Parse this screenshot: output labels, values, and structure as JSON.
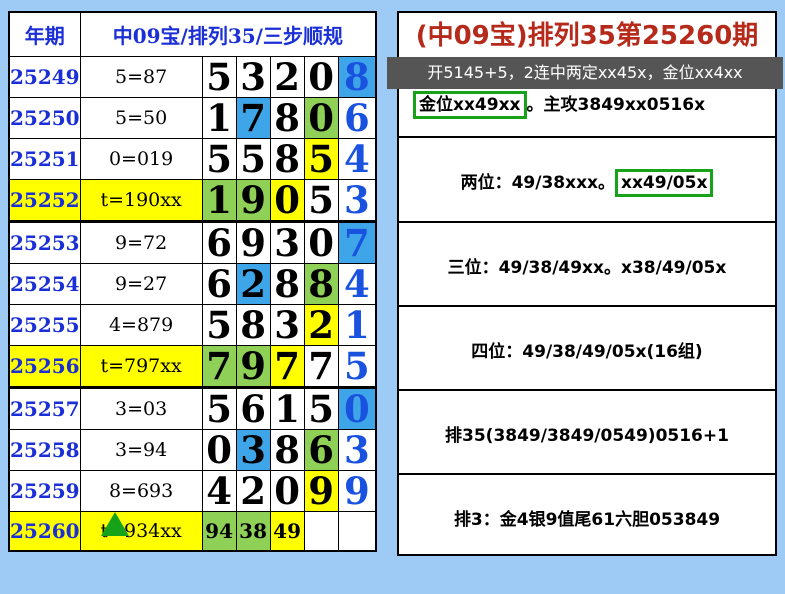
{
  "header": {
    "col_period": "年期",
    "col_title": "中09宝/排列35/三步顺规"
  },
  "rows": [
    {
      "period": "25249",
      "rule": "5=87",
      "highlight": false,
      "digits": [
        "5",
        "3",
        "2",
        "0",
        "8"
      ],
      "bgs": [
        "white",
        "white",
        "white",
        "white",
        "blue"
      ]
    },
    {
      "period": "25250",
      "rule": "5=50",
      "highlight": false,
      "digits": [
        "1",
        "7",
        "8",
        "0",
        "6"
      ],
      "bgs": [
        "white",
        "blue",
        "white",
        "green",
        "white"
      ]
    },
    {
      "period": "25251",
      "rule": "0=019",
      "highlight": false,
      "digits": [
        "5",
        "5",
        "8",
        "5",
        "4"
      ],
      "bgs": [
        "white",
        "white",
        "white",
        "yellow",
        "white"
      ]
    },
    {
      "period": "25252",
      "rule": "t=190xx",
      "highlight": true,
      "digits": [
        "1",
        "9",
        "0",
        "5",
        "3"
      ],
      "bgs": [
        "green",
        "green",
        "yellow",
        "white",
        "white"
      ]
    },
    {
      "period": "25253",
      "rule": "9=72",
      "highlight": false,
      "digits": [
        "6",
        "9",
        "3",
        "0",
        "7"
      ],
      "bgs": [
        "white",
        "white",
        "white",
        "white",
        "blue"
      ]
    },
    {
      "period": "25254",
      "rule": "9=27",
      "highlight": false,
      "digits": [
        "6",
        "2",
        "8",
        "8",
        "4"
      ],
      "bgs": [
        "white",
        "blue",
        "white",
        "green",
        "white"
      ]
    },
    {
      "period": "25255",
      "rule": "4=879",
      "highlight": false,
      "digits": [
        "5",
        "8",
        "3",
        "2",
        "1"
      ],
      "bgs": [
        "white",
        "white",
        "white",
        "yellow",
        "white"
      ]
    },
    {
      "period": "25256",
      "rule": "t=797xx",
      "highlight": true,
      "digits": [
        "7",
        "9",
        "7",
        "7",
        "5"
      ],
      "bgs": [
        "green",
        "green",
        "yellow",
        "white",
        "white"
      ]
    },
    {
      "period": "25257",
      "rule": "3=03",
      "highlight": false,
      "digits": [
        "5",
        "6",
        "1",
        "5",
        "0"
      ],
      "bgs": [
        "white",
        "white",
        "white",
        "white",
        "blue"
      ]
    },
    {
      "period": "25258",
      "rule": "3=94",
      "highlight": false,
      "digits": [
        "0",
        "3",
        "8",
        "6",
        "3"
      ],
      "bgs": [
        "white",
        "blue",
        "white",
        "green",
        "white"
      ]
    },
    {
      "period": "25259",
      "rule": "8=693",
      "highlight": false,
      "digits": [
        "4",
        "2",
        "0",
        "9",
        "9"
      ],
      "bgs": [
        "white",
        "white",
        "white",
        "yellow",
        "white"
      ]
    },
    {
      "period": "25260",
      "rule": "t=934xx",
      "highlight": true,
      "digits": [
        "94",
        "38",
        "49",
        "",
        ""
      ],
      "bgs": [
        "green",
        "green",
        "yellow",
        "white",
        "white"
      ]
    }
  ],
  "panel": {
    "title": "(中09宝)排列35第25260期",
    "subtitle": "开5145+5，2连中两定xx45x，金位xx4xx",
    "main_boxed": "金位xx49xx",
    "main_rest": "。主攻3849xx0516x",
    "two_pos_label": "两位：49/38xxx。",
    "two_pos_boxed": "xx49/05x",
    "three_pos": "三位：49/38/49xx。x38/49/05x",
    "four_pos": "四位：49/38/49/05x(16组)",
    "pai35": "排35(3849/3849/0549)0516+1",
    "pai3": "排3：金4银9值尾61六胆053849"
  },
  "colors": {
    "blue_text": "#1a2fd6",
    "title_red": "#b52a1a",
    "green_box": "#17a21a",
    "row_yellow": "#ffff00",
    "cell_green": "#8fd056",
    "cell_blue": "#3ea6e8"
  },
  "icons": {
    "pointer": "green-triangle-icon"
  }
}
